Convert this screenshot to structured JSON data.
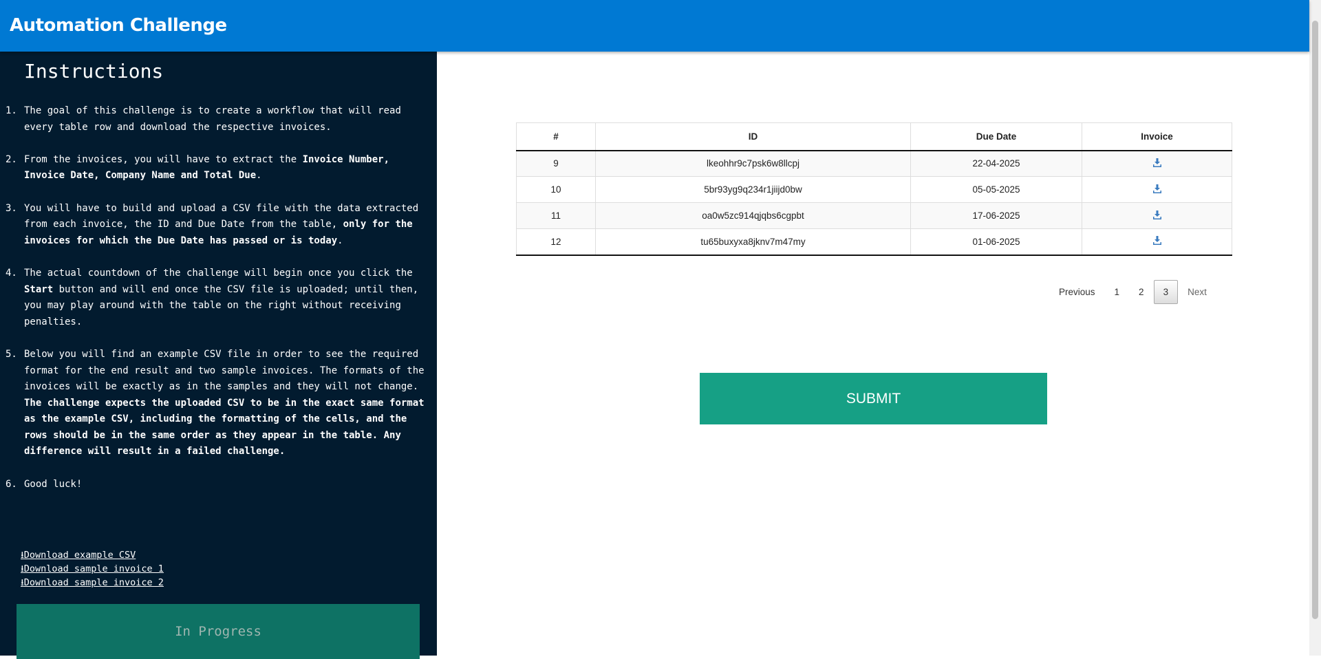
{
  "header": {
    "title": "Automation Challenge"
  },
  "sidebar": {
    "title": "Instructions",
    "items": [
      {
        "num": "1.",
        "text": "The goal of this challenge is to create a workflow that will read every table row and download the respective invoices."
      },
      {
        "num": "2.",
        "pre": "From the invoices, you will have to extract the ",
        "bold": "Invoice Number, Invoice Date, Company Name and Total Due",
        "post": "."
      },
      {
        "num": "3.",
        "pre": "You will have to build and upload a CSV file with the data extracted from each invoice, the ID and Due Date from the table, ",
        "bold": "only for the invoices for which the Due Date has passed or is today",
        "post": "."
      },
      {
        "num": "4.",
        "pre": "The actual countdown of the challenge will begin once you click the ",
        "bold": "Start",
        "post": " button and will end once the CSV file is uploaded; until then, you may play around with the table on the right without receiving penalties."
      },
      {
        "num": "5.",
        "pre": "Below you will find an example CSV file in order to see the required format for the end result and two sample invoices. The formats of the invoices will be exactly as in the samples and they will not change. ",
        "bold": "The challenge expects the uploaded CSV to be in the exact same format as the example CSV, including the formatting of the cells, and the rows should be in the same order as they appear in the table. Any difference will result in a failed challenge.",
        "post": ""
      },
      {
        "num": "6.",
        "text": "Good luck!"
      }
    ],
    "links": [
      "Download example CSV",
      "Download sample invoice 1",
      "Download sample invoice 2"
    ],
    "status_button": "In Progress"
  },
  "table": {
    "headers": [
      "#",
      "ID",
      "Due Date",
      "Invoice"
    ],
    "rows": [
      {
        "n": "9",
        "id": "lkeohhr9c7psk6w8llcpj",
        "due": "22-04-2025"
      },
      {
        "n": "10",
        "id": "5br93yg9q234r1jiijd0bw",
        "due": "05-05-2025"
      },
      {
        "n": "11",
        "id": "oa0w5zc914qjqbs6cgpbt",
        "due": "17-06-2025"
      },
      {
        "n": "12",
        "id": "tu65buxyxa8jknv7m47my",
        "due": "01-06-2025"
      }
    ]
  },
  "pagination": {
    "previous": "Previous",
    "pages": [
      "1",
      "2",
      "3"
    ],
    "current": "3",
    "next": "Next"
  },
  "submit_label": "SUBMIT"
}
